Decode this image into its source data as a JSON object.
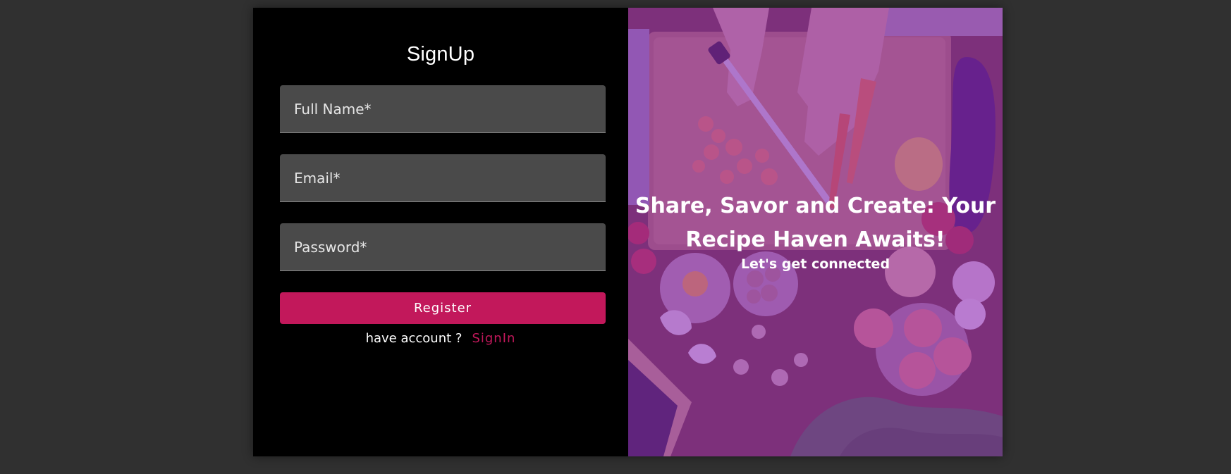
{
  "form": {
    "title": "SignUp",
    "fields": {
      "full_name": {
        "placeholder": "Full Name*",
        "value": ""
      },
      "email": {
        "placeholder": "Email*",
        "value": ""
      },
      "password": {
        "placeholder": "Password*",
        "value": ""
      }
    },
    "register_label": "Register",
    "account_question": "have account ?",
    "signin_label": "SignIn"
  },
  "hero": {
    "headline": "Share, Savor and Create: Your Recipe Haven Awaits!",
    "subheadline": "Let's get connected"
  },
  "colors": {
    "background": "#303030",
    "form_panel": "#000000",
    "input_bg": "#4a4a4a",
    "accent": "#c2185b",
    "overlay": "#8c28be"
  }
}
